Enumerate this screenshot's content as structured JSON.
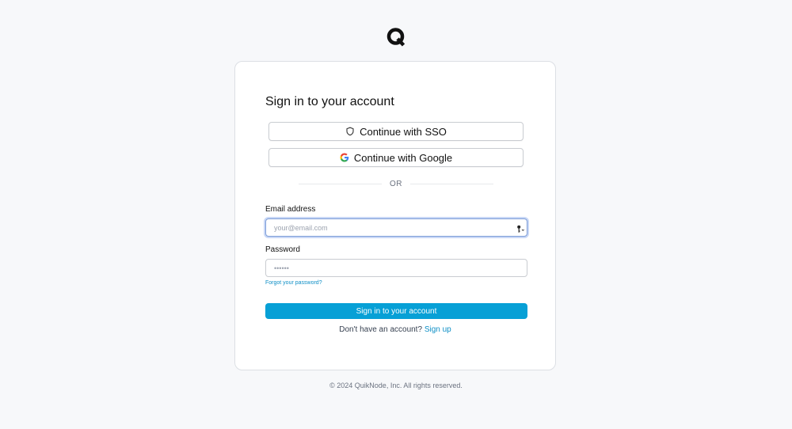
{
  "brand": {
    "logo_icon": "quiknode-q-logo-icon"
  },
  "login": {
    "heading": "Sign in to your account",
    "sso_button": {
      "label": "Continue with SSO",
      "icon": "shield-icon"
    },
    "google_button": {
      "label": "Continue with Google",
      "icon": "google-g-icon"
    },
    "divider_text": "OR",
    "email": {
      "label": "Email address",
      "value": "",
      "placeholder": "your@email.com",
      "autofill_icon": "key-icon"
    },
    "password": {
      "label": "Password",
      "value": "",
      "placeholder": "••••••"
    },
    "forgot_password": "Forgot your password?",
    "submit_label": "Sign in to your account",
    "signup_prompt": "Don't have an account?",
    "signup_link": "Sign up"
  },
  "footer": {
    "copyright": "© 2024 QuikNode, Inc. All rights reserved."
  },
  "colors": {
    "page_bg": "#f7f8fa",
    "primary": "#07a0d6",
    "link": "#0e8fc6",
    "focus_border": "#7f9ed8"
  }
}
